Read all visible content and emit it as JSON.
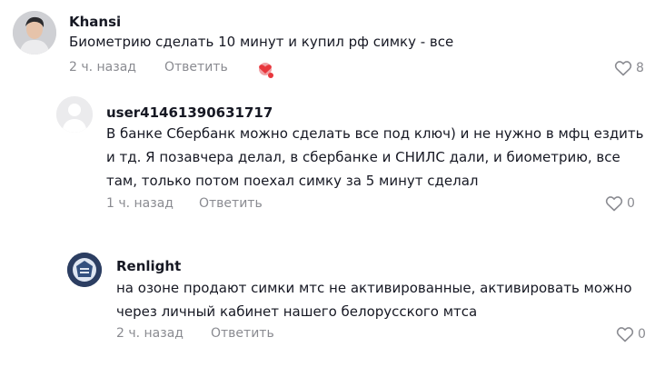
{
  "comments": [
    {
      "username": "Khansi",
      "text": "Биометрию сделать 10 минут и купил рф симку - все",
      "time": "2 ч. назад",
      "reply": "Ответить",
      "likes": "8",
      "avatar_icon": "user-photo-avatar",
      "creator_liked_icon": "creator-liked-icon"
    },
    {
      "username": "user41461390631717",
      "text_lines": [
        "В банке Сбербанк можно сделать все под ключ) и не нужно в мфц ездить",
        "и тд. Я позавчера делал, в сбербанке и СНИЛС дали, и биометрию, все",
        "там, только потом поехал симку за 5 минут сделал"
      ],
      "time": "1 ч. назад",
      "reply": "Ответить",
      "likes": "0",
      "avatar_icon": "default-avatar"
    },
    {
      "username": "Renlight",
      "text_lines": [
        "на озоне продают симки мтс не активированные, активировать можно",
        "через личный кабинет нашего белорусского мтса"
      ],
      "time": "2 ч. назад",
      "reply": "Ответить",
      "likes": "0",
      "avatar_icon": "picture-avatar"
    }
  ],
  "colors": {
    "text": "#161823",
    "muted": "#8a8b91",
    "creator_badge": "#e8363c"
  }
}
